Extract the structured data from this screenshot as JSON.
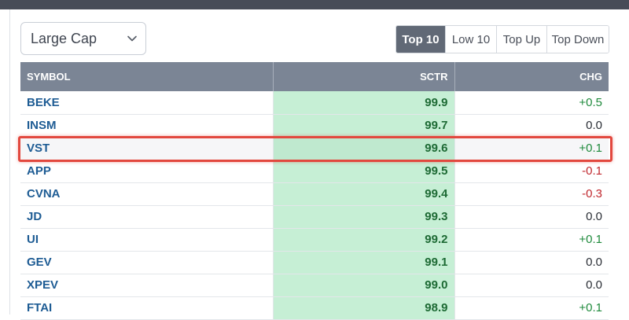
{
  "selector": {
    "value": "Large Cap",
    "icon": "chevron-down-icon"
  },
  "filters": {
    "options": [
      "Top 10",
      "Low 10",
      "Top Up",
      "Top Down"
    ],
    "active": "Top 10"
  },
  "table": {
    "headers": {
      "symbol": "SYMBOL",
      "sctr": "SCTR",
      "chg": "CHG"
    },
    "rows": [
      {
        "symbol": "BEKE",
        "sctr": "99.9",
        "chg": "+0.5"
      },
      {
        "symbol": "INSM",
        "sctr": "99.7",
        "chg": "0.0"
      },
      {
        "symbol": "VST",
        "sctr": "99.6",
        "chg": "+0.1"
      },
      {
        "symbol": "APP",
        "sctr": "99.5",
        "chg": "-0.1"
      },
      {
        "symbol": "CVNA",
        "sctr": "99.4",
        "chg": "-0.3"
      },
      {
        "symbol": "JD",
        "sctr": "99.3",
        "chg": "0.0"
      },
      {
        "symbol": "UI",
        "sctr": "99.2",
        "chg": "+0.1"
      },
      {
        "symbol": "GEV",
        "sctr": "99.1",
        "chg": "0.0"
      },
      {
        "symbol": "XPEV",
        "sctr": "99.0",
        "chg": "0.0"
      },
      {
        "symbol": "FTAI",
        "sctr": "98.9",
        "chg": "+0.1"
      }
    ],
    "highlighted_symbol": "VST"
  },
  "colors": {
    "topbar": "#474c57",
    "header_bg": "#7b8595",
    "sctr_cell_bg": "#c6efd5",
    "positive": "#1f8a3c",
    "negative": "#c0272d",
    "symbol_link": "#1e5c94",
    "highlight_border": "#e2483e"
  }
}
